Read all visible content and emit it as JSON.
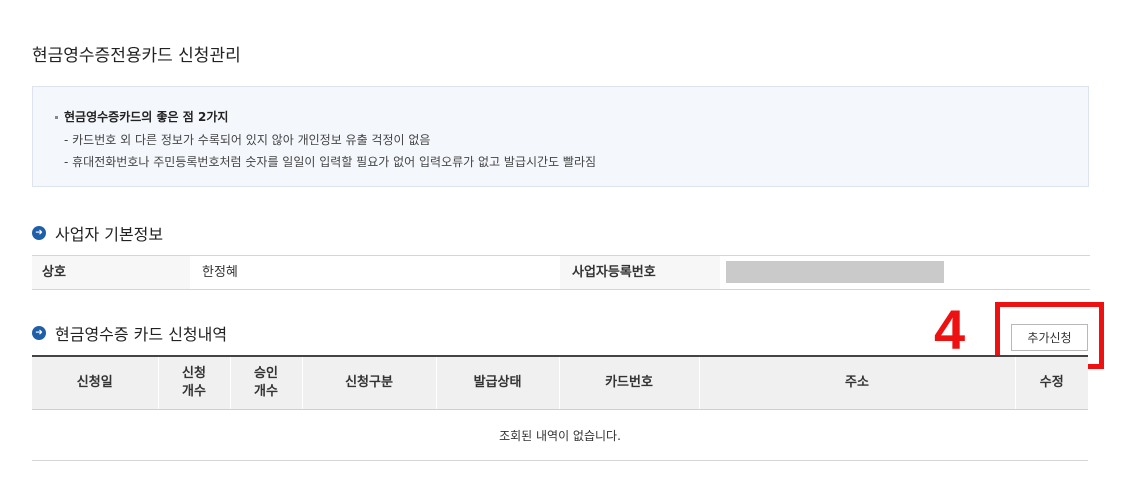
{
  "page": {
    "title": "현금영수증전용카드 신청관리"
  },
  "info": {
    "heading": "현금영수증카드의 좋은 점 2가지",
    "lines": [
      "- 카드번호 외 다른 정보가 수록되어 있지 않아 개인정보 유출 걱정이 없음",
      "- 휴대전화번호나 주민등록번호처럼 숫자를 일일이 입력할 필요가 없어 입력오류가 없고 발급시간도 빨라짐"
    ]
  },
  "business": {
    "section_title": "사업자 기본정보",
    "name_label": "상호",
    "name_value": "한정혜",
    "reg_label": "사업자등록번호",
    "reg_value_masked": true
  },
  "applications": {
    "section_title": "현금영수증 카드 신청내역",
    "add_button": "추가신청",
    "step_marker": "4",
    "columns": [
      "신청일",
      "신청\n개수",
      "승인\n개수",
      "신청구분",
      "발급상태",
      "카드번호",
      "주소",
      "수정"
    ],
    "empty_message": "조회된 내역이 없습니다."
  },
  "colors": {
    "highlight": "#ee1111",
    "section_icon": "#1f5fa8",
    "info_bg": "#f4f7fc"
  },
  "icons": {
    "section": "arrow-circle-icon"
  }
}
